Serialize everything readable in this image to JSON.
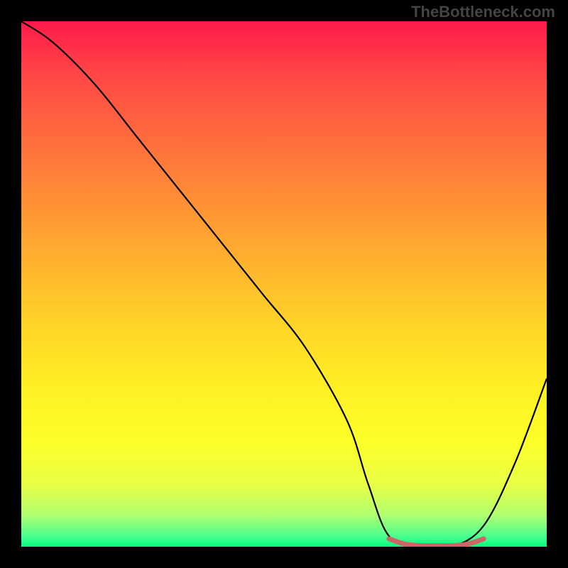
{
  "watermark": "TheBottleneck.com",
  "chart_data": {
    "type": "line",
    "title": "",
    "xlabel": "",
    "ylabel": "",
    "xlim": [
      0,
      100
    ],
    "ylim": [
      0,
      100
    ],
    "grid": false,
    "series": [
      {
        "name": "bottleneck-curve",
        "x": [
          0,
          6,
          14,
          22,
          30,
          38,
          46,
          54,
          62,
          66,
          70,
          76,
          82,
          88,
          94,
          100
        ],
        "y": [
          100,
          96,
          88,
          78,
          68,
          58,
          48,
          38,
          24,
          12,
          2,
          0,
          0,
          4,
          16,
          32
        ],
        "color": "#000000"
      },
      {
        "name": "optimal-zone",
        "x": [
          70,
          73,
          76,
          79,
          82,
          85,
          88
        ],
        "y": [
          1.5,
          0.5,
          0.2,
          0.2,
          0.2,
          0.5,
          1.5
        ],
        "color": "#cc6666"
      }
    ],
    "background_gradient": {
      "top": "#ff1a4a",
      "middle": "#ffd528",
      "bottom": "#00ff80"
    }
  }
}
